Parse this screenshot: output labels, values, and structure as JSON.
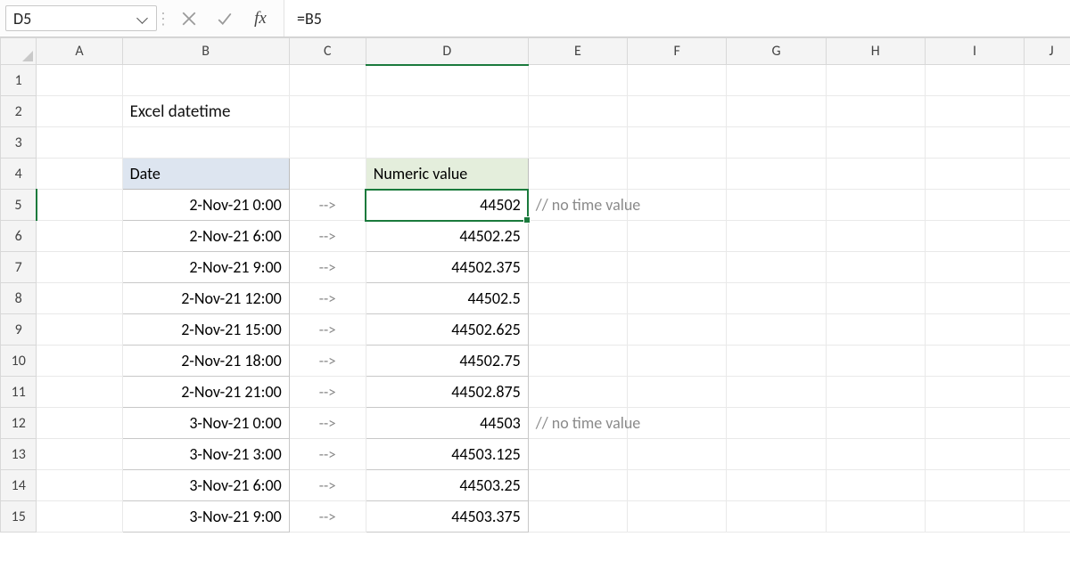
{
  "namebox": {
    "ref": "D5"
  },
  "formula_bar": {
    "formula": "=B5",
    "fx_label": "fx"
  },
  "columns": [
    "A",
    "B",
    "C",
    "D",
    "E",
    "F",
    "G",
    "H",
    "I",
    "J"
  ],
  "rows_visible": [
    1,
    2,
    3,
    4,
    5,
    6,
    7,
    8,
    9,
    10,
    11,
    12,
    13,
    14,
    15
  ],
  "title": "Excel datetime",
  "headers": {
    "date": "Date",
    "numeric": "Numeric value"
  },
  "arrow": "-->",
  "data_rows": [
    {
      "date": "2-Nov-21 0:00",
      "numeric": "44502",
      "comment": "// no time value"
    },
    {
      "date": "2-Nov-21 6:00",
      "numeric": "44502.25",
      "comment": ""
    },
    {
      "date": "2-Nov-21 9:00",
      "numeric": "44502.375",
      "comment": ""
    },
    {
      "date": "2-Nov-21 12:00",
      "numeric": "44502.5",
      "comment": ""
    },
    {
      "date": "2-Nov-21 15:00",
      "numeric": "44502.625",
      "comment": ""
    },
    {
      "date": "2-Nov-21 18:00",
      "numeric": "44502.75",
      "comment": ""
    },
    {
      "date": "2-Nov-21 21:00",
      "numeric": "44502.875",
      "comment": ""
    },
    {
      "date": "3-Nov-21 0:00",
      "numeric": "44503",
      "comment": "// no time value"
    },
    {
      "date": "3-Nov-21 3:00",
      "numeric": "44503.125",
      "comment": ""
    },
    {
      "date": "3-Nov-21 6:00",
      "numeric": "44503.25",
      "comment": ""
    },
    {
      "date": "3-Nov-21 9:00",
      "numeric": "44503.375",
      "comment": ""
    }
  ],
  "active_cell": {
    "col": "D",
    "row": 5
  }
}
